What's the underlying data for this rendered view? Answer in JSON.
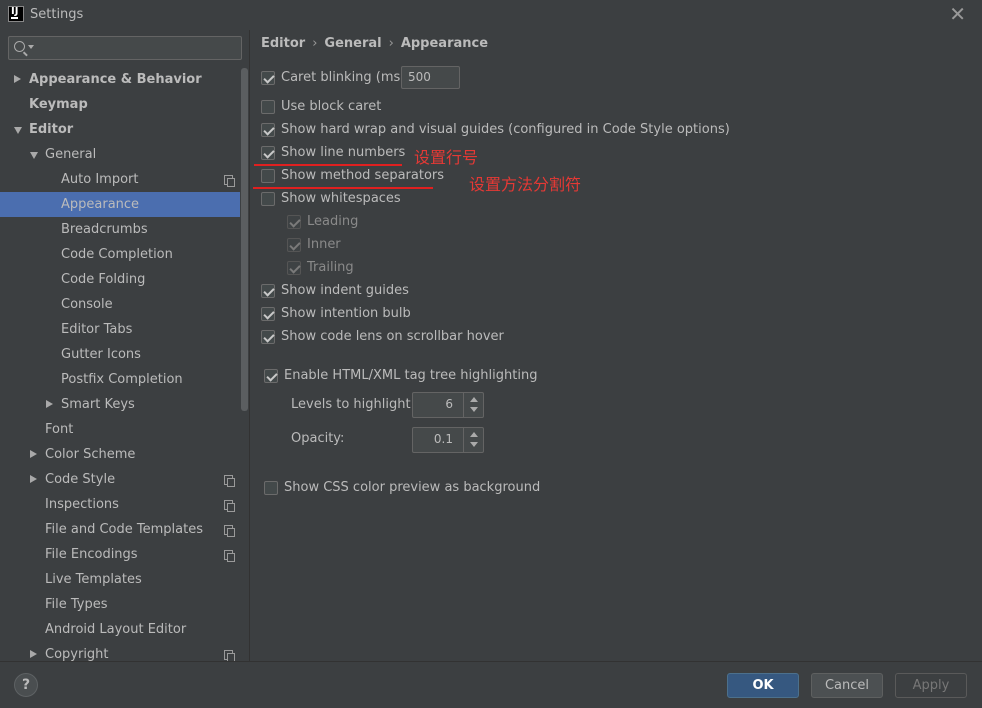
{
  "window": {
    "title": "Settings"
  },
  "search": {
    "placeholder": ""
  },
  "sidebar": {
    "items": [
      {
        "label": "Appearance & Behavior",
        "level": 0,
        "arrow": "right",
        "bold": true,
        "proj": false,
        "selected": false
      },
      {
        "label": "Keymap",
        "level": 0,
        "arrow": "none",
        "bold": true,
        "proj": false,
        "selected": false
      },
      {
        "label": "Editor",
        "level": 0,
        "arrow": "down",
        "bold": true,
        "proj": false,
        "selected": false
      },
      {
        "label": "General",
        "level": 1,
        "arrow": "down",
        "bold": false,
        "proj": false,
        "selected": false
      },
      {
        "label": "Auto Import",
        "level": 2,
        "arrow": "none",
        "bold": false,
        "proj": true,
        "selected": false
      },
      {
        "label": "Appearance",
        "level": 2,
        "arrow": "none",
        "bold": false,
        "proj": false,
        "selected": true
      },
      {
        "label": "Breadcrumbs",
        "level": 2,
        "arrow": "none",
        "bold": false,
        "proj": false,
        "selected": false
      },
      {
        "label": "Code Completion",
        "level": 2,
        "arrow": "none",
        "bold": false,
        "proj": false,
        "selected": false
      },
      {
        "label": "Code Folding",
        "level": 2,
        "arrow": "none",
        "bold": false,
        "proj": false,
        "selected": false
      },
      {
        "label": "Console",
        "level": 2,
        "arrow": "none",
        "bold": false,
        "proj": false,
        "selected": false
      },
      {
        "label": "Editor Tabs",
        "level": 2,
        "arrow": "none",
        "bold": false,
        "proj": false,
        "selected": false
      },
      {
        "label": "Gutter Icons",
        "level": 2,
        "arrow": "none",
        "bold": false,
        "proj": false,
        "selected": false
      },
      {
        "label": "Postfix Completion",
        "level": 2,
        "arrow": "none",
        "bold": false,
        "proj": false,
        "selected": false
      },
      {
        "label": "Smart Keys",
        "level": 2,
        "arrow": "right",
        "bold": false,
        "proj": false,
        "selected": false
      },
      {
        "label": "Font",
        "level": 1,
        "arrow": "none",
        "bold": false,
        "proj": false,
        "selected": false
      },
      {
        "label": "Color Scheme",
        "level": 1,
        "arrow": "right",
        "bold": false,
        "proj": false,
        "selected": false
      },
      {
        "label": "Code Style",
        "level": 1,
        "arrow": "right",
        "bold": false,
        "proj": true,
        "selected": false
      },
      {
        "label": "Inspections",
        "level": 1,
        "arrow": "none",
        "bold": false,
        "proj": true,
        "selected": false
      },
      {
        "label": "File and Code Templates",
        "level": 1,
        "arrow": "none",
        "bold": false,
        "proj": true,
        "selected": false
      },
      {
        "label": "File Encodings",
        "level": 1,
        "arrow": "none",
        "bold": false,
        "proj": true,
        "selected": false
      },
      {
        "label": "Live Templates",
        "level": 1,
        "arrow": "none",
        "bold": false,
        "proj": false,
        "selected": false
      },
      {
        "label": "File Types",
        "level": 1,
        "arrow": "none",
        "bold": false,
        "proj": false,
        "selected": false
      },
      {
        "label": "Android Layout Editor",
        "level": 1,
        "arrow": "none",
        "bold": false,
        "proj": false,
        "selected": false
      },
      {
        "label": "Copyright",
        "level": 1,
        "arrow": "right",
        "bold": false,
        "proj": true,
        "selected": false
      }
    ]
  },
  "breadcrumb": {
    "part1": "Editor",
    "part2": "General",
    "part3": "Appearance",
    "sep": "›"
  },
  "options": {
    "caret_blinking": {
      "label": "Caret blinking (ms):",
      "checked": true,
      "value": "500"
    },
    "block_caret": {
      "label": "Use block caret",
      "checked": false
    },
    "hard_wrap": {
      "label": "Show hard wrap and visual guides (configured in Code Style options)",
      "checked": true
    },
    "line_numbers": {
      "label": "Show line numbers",
      "checked": true
    },
    "method_separators": {
      "label": "Show method separators",
      "checked": false
    },
    "whitespaces": {
      "label": "Show whitespaces",
      "checked": false
    },
    "leading": {
      "label": "Leading",
      "checked": true
    },
    "inner": {
      "label": "Inner",
      "checked": true
    },
    "trailing": {
      "label": "Trailing",
      "checked": true
    },
    "indent_guides": {
      "label": "Show indent guides",
      "checked": true
    },
    "intention_bulb": {
      "label": "Show intention bulb",
      "checked": true
    },
    "code_lens": {
      "label": "Show code lens on scrollbar hover",
      "checked": true
    },
    "tag_tree": {
      "label": "Enable HTML/XML tag tree highlighting",
      "checked": true
    },
    "levels": {
      "label": "Levels to highlight:",
      "value": "6"
    },
    "opacity": {
      "label": "Opacity:",
      "value": "0.1"
    },
    "css_preview": {
      "label": "Show CSS color preview as background",
      "checked": false
    }
  },
  "annotations": {
    "line_numbers": "设置行号",
    "method_separators": "设置方法分割符",
    "color": "#e53935"
  },
  "footer": {
    "help": "?",
    "ok": "OK",
    "cancel": "Cancel",
    "apply": "Apply"
  },
  "colors": {
    "background": "#3c3f41",
    "selection": "#4b6eaf",
    "primary_button": "#365880"
  }
}
